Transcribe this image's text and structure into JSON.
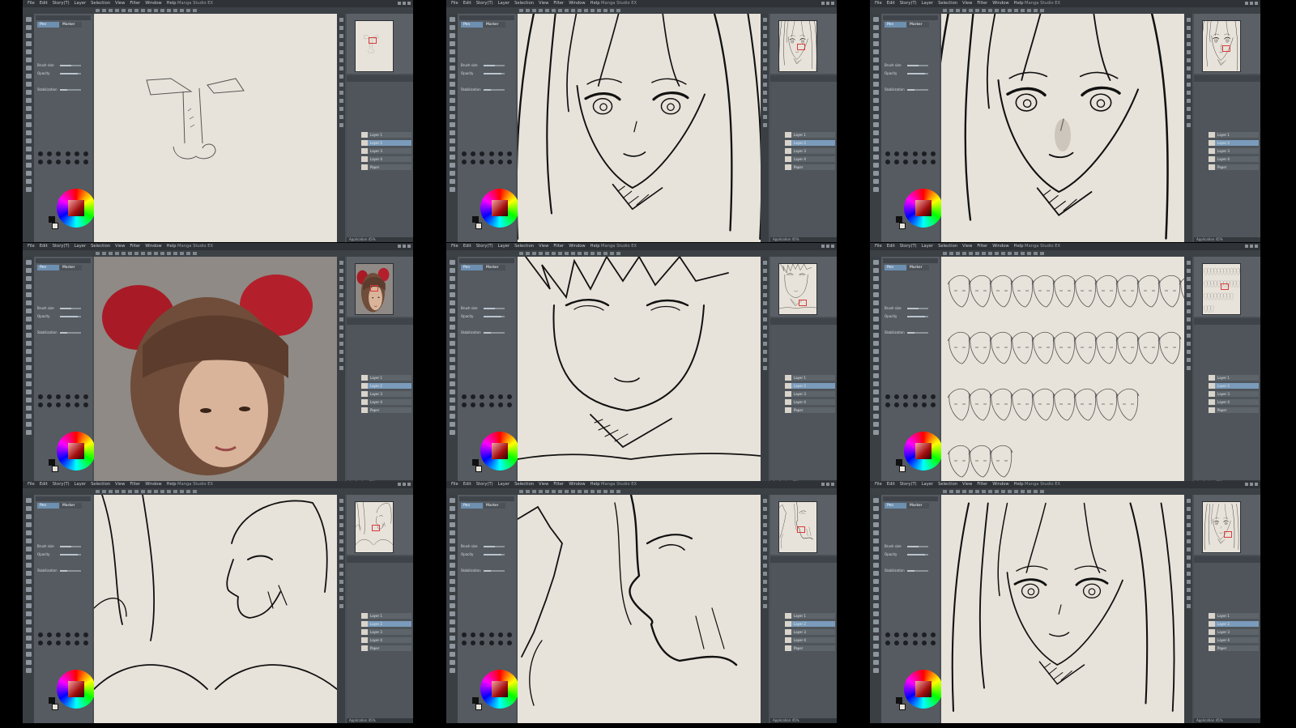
{
  "app": {
    "menu": [
      "File",
      "Edit",
      "Story(T)",
      "Layer",
      "Selection",
      "View",
      "Filter",
      "Window",
      "Help"
    ],
    "window_title": "Manga Studio EX",
    "brush": {
      "size_label": "Brush size",
      "opacity_label": "Opacity",
      "stabilization_label": "Stabilization",
      "pen_tab": "Pen",
      "marker_tab": "Marker"
    },
    "layer_names": [
      "Layer 1",
      "Layer 2",
      "Layer 3",
      "Layer 4",
      "Paper"
    ],
    "blend_label": "100 % Normal",
    "status_label": "Application 45%",
    "colors": {
      "chrome": "#4a4f54",
      "canvas": "#e8e3da",
      "selected_layer": "#7a9bbb",
      "nav_marker": "#d93b3b"
    }
  },
  "panels": [
    {
      "content": "nose-sketch"
    },
    {
      "content": "girl-face-closeup"
    },
    {
      "content": "girl-face-shaded"
    },
    {
      "content": "photo-reference"
    },
    {
      "content": "boy-face-sketch"
    },
    {
      "content": "faces-grid"
    },
    {
      "content": "profile-sketches"
    },
    {
      "content": "profile-closeup"
    },
    {
      "content": "girl-face-medium"
    }
  ]
}
